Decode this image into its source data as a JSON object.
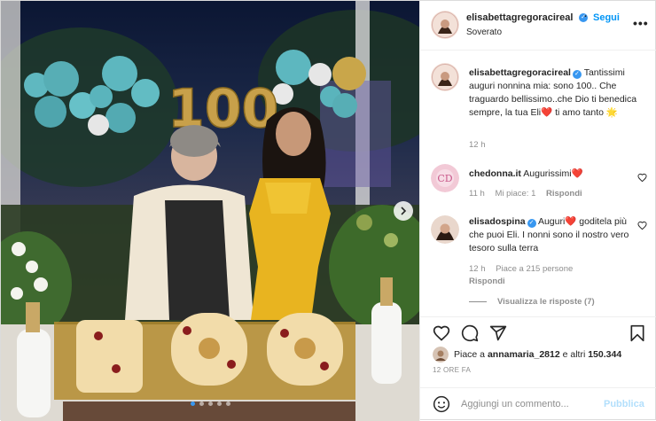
{
  "post": {
    "author": "elisabettagregoracireal",
    "location": "Soverato",
    "follow_label": "Segui",
    "more_icon": "more-horizontal-icon"
  },
  "photo": {
    "balloon_text": "100",
    "carousel_pages": 5,
    "carousel_current": 1
  },
  "comments": [
    {
      "author": "elisabettagregoracireal",
      "verified": true,
      "text": "Tantissimi auguri nonnina mia: sono 100.. Che traguardo bellissimo..che Dio ti benedica sempre, la tua Eli❤️ ti amo tanto 🌟",
      "time": "12 h"
    },
    {
      "author": "chedonna.it",
      "verified": false,
      "text": "Augurissimi❤️",
      "time": "11 h",
      "likes": "Mi piace: 1",
      "reply_label": "Rispondi"
    },
    {
      "author": "elisadospina",
      "verified": true,
      "text": "Auguri❤️ goditela più che puoi Eli. I nonni sono il nostro vero tesoro sulla terra",
      "time": "12 h",
      "likes": "Piace a 215 persone",
      "reply_label": "Rispondi"
    }
  ],
  "view_replies": "Visualizza le risposte (7)",
  "likes": {
    "prefix": "Piace a ",
    "user": "annamaria_2812",
    "middle": " e altri ",
    "count": "150.344"
  },
  "timestamp": "12 ORE FA",
  "add_comment": {
    "placeholder": "Aggiungi un commento...",
    "post_label": "Pubblica"
  },
  "colors": {
    "accent": "#0095f6",
    "verified": "#3897f0",
    "heart": "#ed4956"
  }
}
